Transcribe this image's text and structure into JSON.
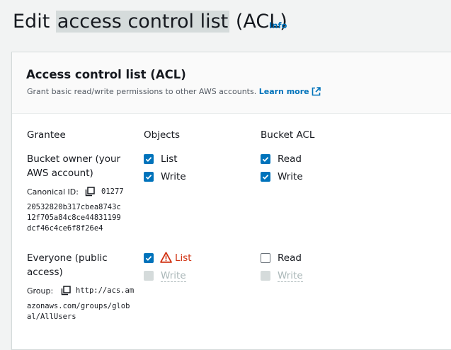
{
  "page": {
    "title_prefix": "Edit ",
    "title_highlight": "access control list",
    "title_suffix": " (ACL)",
    "info_link": "Info"
  },
  "panel": {
    "title": "Access control list (ACL)",
    "description": "Grant basic read/write permissions to other AWS accounts.",
    "learn_more": "Learn more",
    "external_icon": "external-link-icon"
  },
  "columns": {
    "grantee": "Grantee",
    "objects": "Objects",
    "bucket_acl": "Bucket ACL"
  },
  "grantees": [
    {
      "name_line1": "Bucket owner (your",
      "name_line2": "AWS account)",
      "id_label": "Canonical ID:",
      "id_lines": [
        "01277",
        "20532820b317cbea8743c",
        "12f705a84c8ce44831199",
        "dcf46c4ce6f8f26e4"
      ],
      "copy_icon": "copy-icon",
      "objects": [
        {
          "label": "List",
          "checked": true,
          "disabled": false
        },
        {
          "label": "Write",
          "checked": true,
          "disabled": false
        }
      ],
      "bucket_acl": [
        {
          "label": "Read",
          "checked": true,
          "disabled": false
        },
        {
          "label": "Write",
          "checked": true,
          "disabled": false
        }
      ]
    },
    {
      "name_line1": "Everyone (public",
      "name_line2": "access)",
      "id_label": "Group:",
      "id_lines": [
        "http://acs.am",
        "azonaws.com/groups/glob",
        "al/AllUsers"
      ],
      "copy_icon": "copy-icon",
      "objects": [
        {
          "label": "List",
          "checked": true,
          "disabled": false,
          "warning_icon": "warning-icon"
        },
        {
          "label": "Write",
          "checked": false,
          "disabled": true
        }
      ],
      "bucket_acl": [
        {
          "label": "Read",
          "checked": false,
          "disabled": false
        },
        {
          "label": "Write",
          "checked": false,
          "disabled": true
        }
      ]
    }
  ],
  "colors": {
    "accent": "#0073bb",
    "warning": "#d13212",
    "disabled": "#aab7b8",
    "highlight": "#d5dbdb"
  }
}
